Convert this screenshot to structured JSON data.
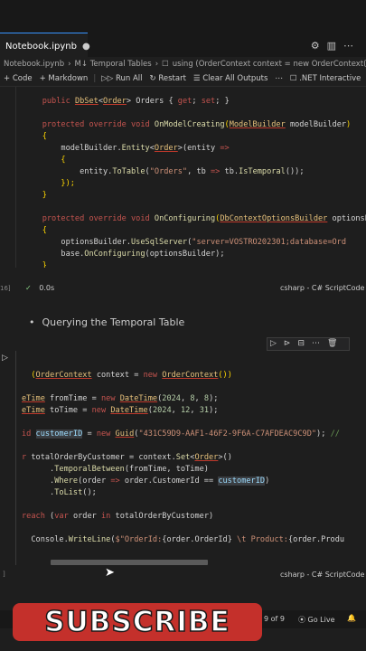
{
  "window": {
    "tab_label": "Notebook.ipynb"
  },
  "breadcrumb": [
    "Notebook.ipynb",
    "M↓ Temporal Tables",
    "using (OrderContext context = new OrderContext())"
  ],
  "toolbar": {
    "code_label": "Code",
    "markdown_label": "Markdown",
    "run_all_label": "Run All",
    "restart_label": "Restart",
    "clear_label": "Clear All Outputs",
    "interactive_label": ".NET Interactive"
  },
  "cell1": {
    "lines": [
      "    public DbSet<Order> Orders { get; set; }",
      "",
      "    protected override void OnModelCreating(ModelBuilder modelBuilder)",
      "    {",
      "        modelBuilder.Entity<Order>(entity =>",
      "        {",
      "            entity.ToTable(\"Orders\", tb => tb.IsTemporal());",
      "        });",
      "    }",
      "",
      "    protected override void OnConfiguring(DbContextOptionsBuilder optionsBuilder)",
      "    {",
      "        optionsBuilder.UseSqlServer(\"server=VOSTRO202301;database=Ord",
      "        base.OnConfiguring(optionsBuilder);",
      "    }",
      "}"
    ],
    "exec_count": "16]",
    "time": "0.0s",
    "lang": "csharp - C# Script",
    "kind": "Code"
  },
  "markdown": {
    "bullet": "Querying the Temporal Table"
  },
  "cell2": {
    "lines": [
      "(OrderContext context = new OrderContext())",
      "",
      "eTime fromTime = new DateTime(2024, 8, 8);",
      "eTime toTime = new DateTime(2024, 12, 31);",
      "",
      "id customerID = new Guid(\"431C59D9-AAF1-46F2-9F6A-C7AFDEAC9C9D\"); //",
      "",
      "r totalOrderByCustomer = context.Set<Order>()",
      "      .TemporalBetween(fromTime, toTime)",
      "      .Where(order => order.CustomerId == customerID)",
      "      .ToList();",
      "",
      "reach (var order in totalOrderByCustomer)",
      "",
      "  Console.WriteLine($\"OrderId:{order.OrderId} \\t Product:{order.Produ"
    ],
    "exec_count": "]",
    "lang": "csharp - C# Script",
    "kind": "Code"
  },
  "status": {
    "position": "9 of 9",
    "go_live": "Go Live"
  },
  "overlay": {
    "subscribe_label": "SUBSCRIBE"
  }
}
